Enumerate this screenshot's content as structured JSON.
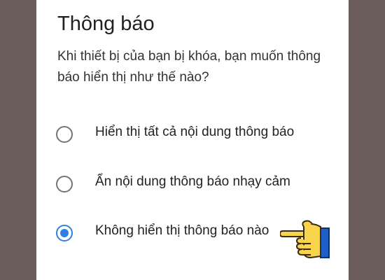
{
  "dialog": {
    "title": "Thông báo",
    "message": "Khi thiết bị của bạn bị khóa, bạn muốn thông báo hiển thị như thế nào?",
    "options": [
      {
        "label": "Hiển thị tất cả nội dung thông báo",
        "selected": false
      },
      {
        "label": "Ẩn nội dung thông báo nhạy cảm",
        "selected": false
      },
      {
        "label": "Không hiển thị thông báo nào",
        "selected": true
      }
    ]
  },
  "colors": {
    "backdrop": "#6b5d5c",
    "accent": "#2f7fe6",
    "radio_unchecked": "#757575",
    "hand_fill": "#f7d44a",
    "cuff": "#1f5fc8"
  },
  "icons": {
    "pointer": "pointing-hand-icon"
  }
}
